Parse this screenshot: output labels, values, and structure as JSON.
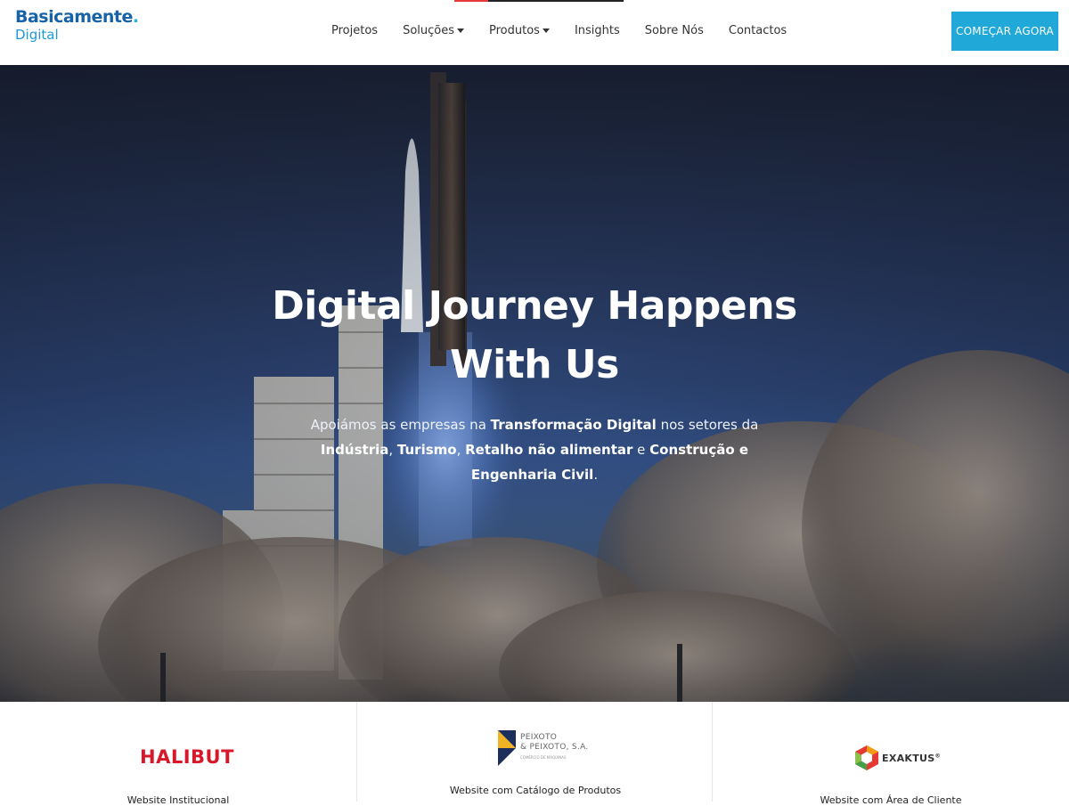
{
  "header": {
    "logo_main": "Basicamente",
    "logo_dot": ".",
    "logo_sub": "Digital",
    "nav": [
      {
        "label": "Projetos",
        "dropdown": false
      },
      {
        "label": "Soluções",
        "dropdown": true
      },
      {
        "label": "Produtos",
        "dropdown": true
      },
      {
        "label": "Insights",
        "dropdown": false
      },
      {
        "label": "Sobre Nós",
        "dropdown": false
      },
      {
        "label": "Contactos",
        "dropdown": false
      }
    ],
    "cta_label": "COMEÇAR AGORA"
  },
  "hero": {
    "title_line1": "Digital Journey Happens",
    "title_line2": "With Us",
    "text": {
      "p1": "Apoiámos as empresas na ",
      "b1": "Transformação Digital",
      "p2": " nos setores da ",
      "b2": "Indústria",
      "p3": ", ",
      "b3": "Turismo",
      "p4": ", ",
      "b4": "Retalho não alimentar",
      "p5": " e ",
      "b5": "Construção e Engenharia Civil",
      "p6": "."
    }
  },
  "clients": [
    {
      "logo_text": "HALIBUT",
      "caption": "Website Institucional"
    },
    {
      "logo_text_line1": "PEIXOTO",
      "logo_text_line2": "& PEIXOTO, S.A.",
      "logo_tagline": "COMÉRCIO DE MÁQUINAS",
      "caption": "Website com Catálogo de Produtos"
    },
    {
      "logo_text": "EXAKTUS",
      "logo_mark": "®",
      "caption": "Website com Área de Cliente"
    }
  ],
  "colors": {
    "brand_blue": "#1763a8",
    "brand_light": "#1c9ad6",
    "cta": "#1fa8d8",
    "halibut_red": "#d7182a"
  }
}
